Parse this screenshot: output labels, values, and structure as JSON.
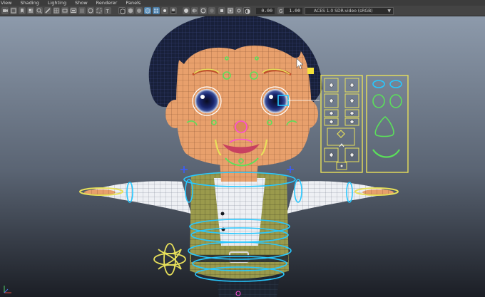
{
  "menu": [
    "View",
    "Shading",
    "Lighting",
    "Show",
    "Renderer",
    "Panels"
  ],
  "toolbar": {
    "exposure_value": "0.00",
    "gamma_value": "1.00",
    "color_space": "ACES 1.0 SDR-video (sRGB)"
  },
  "colors": {
    "background_top": "#8a97a8",
    "background_bottom": "#1e222a",
    "rig_yellow": "#e8e05a",
    "rig_green": "#5be05a",
    "rig_cyan": "#27c8ff",
    "rig_blue": "#3a5cff",
    "rig_pink": "#ff4fd8"
  }
}
